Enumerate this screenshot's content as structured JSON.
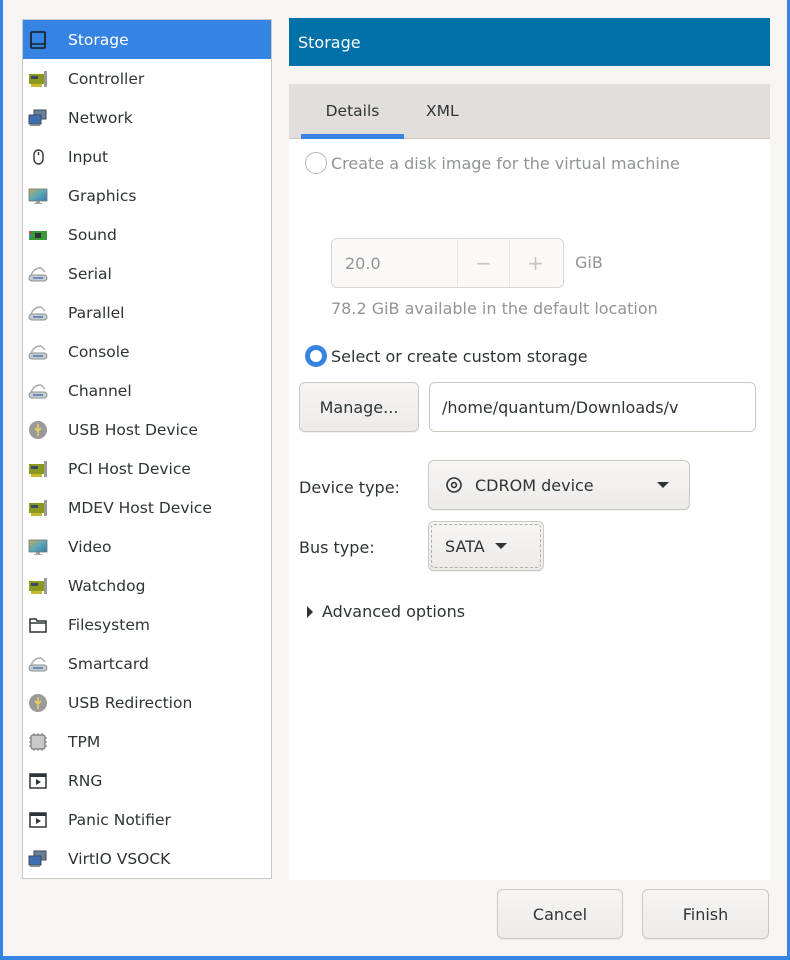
{
  "sidebar": {
    "items": [
      {
        "label": "Storage",
        "icon": "storage-icon",
        "selected": true
      },
      {
        "label": "Controller",
        "icon": "pci-card-icon"
      },
      {
        "label": "Network",
        "icon": "network-icon"
      },
      {
        "label": "Input",
        "icon": "mouse-icon"
      },
      {
        "label": "Graphics",
        "icon": "monitor-icon"
      },
      {
        "label": "Sound",
        "icon": "sound-card-icon"
      },
      {
        "label": "Serial",
        "icon": "serial-port-icon"
      },
      {
        "label": "Parallel",
        "icon": "serial-port-icon"
      },
      {
        "label": "Console",
        "icon": "serial-port-icon"
      },
      {
        "label": "Channel",
        "icon": "serial-port-icon"
      },
      {
        "label": "USB Host Device",
        "icon": "usb-icon"
      },
      {
        "label": "PCI Host Device",
        "icon": "pci-card-icon"
      },
      {
        "label": "MDEV Host Device",
        "icon": "pci-card-icon"
      },
      {
        "label": "Video",
        "icon": "monitor-icon"
      },
      {
        "label": "Watchdog",
        "icon": "pci-card-icon"
      },
      {
        "label": "Filesystem",
        "icon": "folder-icon"
      },
      {
        "label": "Smartcard",
        "icon": "serial-port-icon"
      },
      {
        "label": "USB Redirection",
        "icon": "usb-icon"
      },
      {
        "label": "TPM",
        "icon": "chip-icon"
      },
      {
        "label": "RNG",
        "icon": "window-play-icon"
      },
      {
        "label": "Panic Notifier",
        "icon": "window-play-icon"
      },
      {
        "label": "VirtIO VSOCK",
        "icon": "network-icon"
      }
    ]
  },
  "header": {
    "title": "Storage"
  },
  "tabs": [
    {
      "label": "Details",
      "active": true
    },
    {
      "label": "XML",
      "active": false
    }
  ],
  "details": {
    "create_disk_label": "Create a disk image for the virtual machine",
    "create_disk_selected": false,
    "disk_size_value": "20.0",
    "decrement_label": "−",
    "increment_label": "+",
    "disk_size_unit": "GiB",
    "available_text": "78.2 GiB available in the default location",
    "custom_storage_label": "Select or create custom storage",
    "custom_storage_selected": true,
    "manage_button": "Manage...",
    "storage_path": "/home/quantum/Downloads/v",
    "device_type_label": "Device type:",
    "device_type_value": "CDROM device",
    "device_type_icon": "cdrom-icon",
    "bus_type_label": "Bus type:",
    "bus_type_value": "SATA",
    "advanced_options_label": "Advanced options"
  },
  "footer": {
    "cancel_button": "Cancel",
    "finish_button": "Finish"
  },
  "colors": {
    "accent": "#3584e4",
    "header_bg": "#0070a8",
    "window_bg": "#f6f5f4"
  }
}
